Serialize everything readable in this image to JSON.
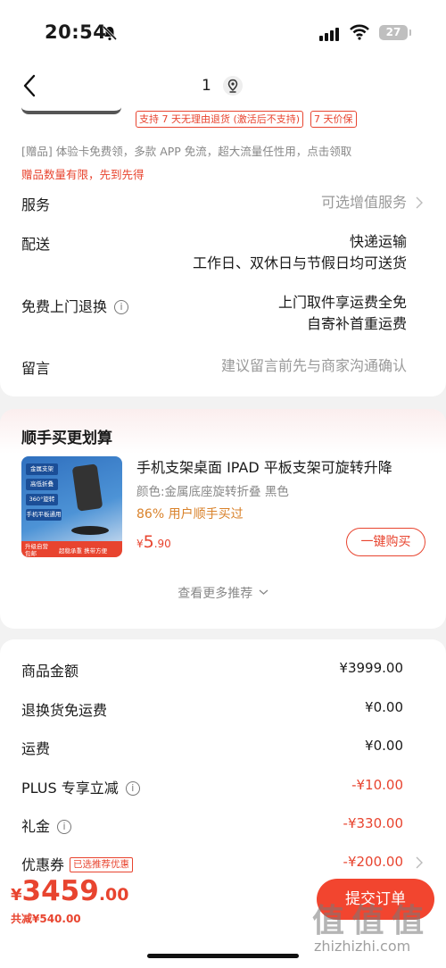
{
  "status": {
    "time": "20:54",
    "battery": "27"
  },
  "nav": {
    "count": "1"
  },
  "tags": [
    "支持 7 天无理由退货 (激活后不支持)",
    "7 天价保"
  ],
  "gift": {
    "text": "[赠品] 体验卡免费领，多款 APP 免流，超大流量任性用，点击领取",
    "warning": "赠品数量有限，先到先得"
  },
  "rows": {
    "service": {
      "label": "服务",
      "value": "可选增值服务"
    },
    "delivery": {
      "label": "配送",
      "value1": "快递运输",
      "value2": "工作日、双休日与节假日均可送货"
    },
    "return": {
      "label": "免费上门退换",
      "value1": "上门取件享运费全免",
      "value2": "自寄补首重运费"
    },
    "note": {
      "label": "留言",
      "value": "建议留言前先与商家沟通确认"
    }
  },
  "upsell": {
    "title": "顺手买更划算",
    "image_labels": [
      "金属支架",
      "高低折叠",
      "360°旋转",
      "手机平板通用"
    ],
    "image_bar": [
      "升级自营",
      "包邮",
      "超稳承重 携带方便"
    ],
    "product": {
      "title": "手机支架桌面 IPAD 平板支架可旋转升降",
      "variant": "颜色:金属底座旋转折叠 黑色",
      "buyers": "86% 用户顺手买过",
      "price_symbol": "¥",
      "price_int": "5",
      "price_dec": ".90",
      "buy_label": "一键购买"
    },
    "more": "查看更多推荐"
  },
  "summary": {
    "goods": {
      "label": "商品金额",
      "value": "¥3999.00"
    },
    "return_fee": {
      "label": "退换货免运费",
      "value": "¥0.00"
    },
    "shipping": {
      "label": "运费",
      "value": "¥0.00"
    },
    "plus": {
      "label": "PLUS 专享立减",
      "value": "-¥10.00"
    },
    "gift_money": {
      "label": "礼金",
      "value": "-¥330.00"
    },
    "coupon": {
      "label": "优惠券",
      "badge": "已选推荐优惠",
      "value": "-¥200.00"
    }
  },
  "footer": {
    "yen": "¥",
    "total_int": "3459",
    "total_dec": ".00",
    "saved": "共减¥540.00",
    "submit": "提交订单",
    "watermark": "值 值 值",
    "watermark_sub": "zhizhizhi.com"
  },
  "colors": {
    "accent": "#e8442f",
    "orange": "#d9822b"
  }
}
